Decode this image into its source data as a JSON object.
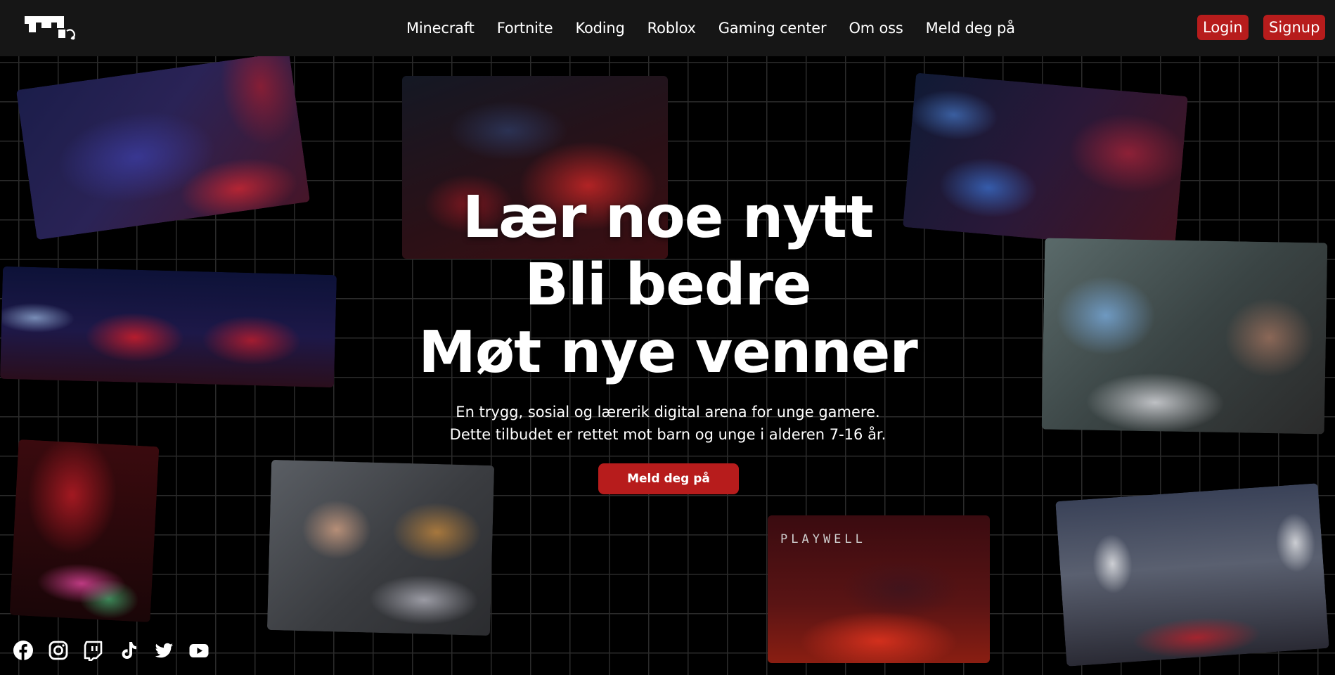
{
  "nav": {
    "items": [
      {
        "label": "Minecraft"
      },
      {
        "label": "Fortnite"
      },
      {
        "label": "Koding"
      },
      {
        "label": "Roblox"
      },
      {
        "label": "Gaming center"
      },
      {
        "label": "Om oss"
      },
      {
        "label": "Meld deg på"
      }
    ],
    "login_label": "Login",
    "signup_label": "Signup"
  },
  "hero": {
    "line1": "Lær noe nytt",
    "line2": "Bli bedre",
    "line3": "Møt nye venner",
    "sub1": "En trygg, sosial og lærerik digital arena for unge gamere.",
    "sub2": "Dette tilbudet er rettet mot barn og unge i alderen 7-16 år.",
    "cta_label": "Meld deg på"
  },
  "photos": {
    "gaming_center_brand": "PLAYWELL"
  },
  "social": [
    "facebook-icon",
    "instagram-icon",
    "twitch-icon",
    "tiktok-icon",
    "twitter-icon",
    "youtube-icon"
  ],
  "colors": {
    "accent": "#b71c1c",
    "header_bg": "#161616",
    "page_bg": "#000000",
    "grid_line": "#2b2b2b"
  }
}
